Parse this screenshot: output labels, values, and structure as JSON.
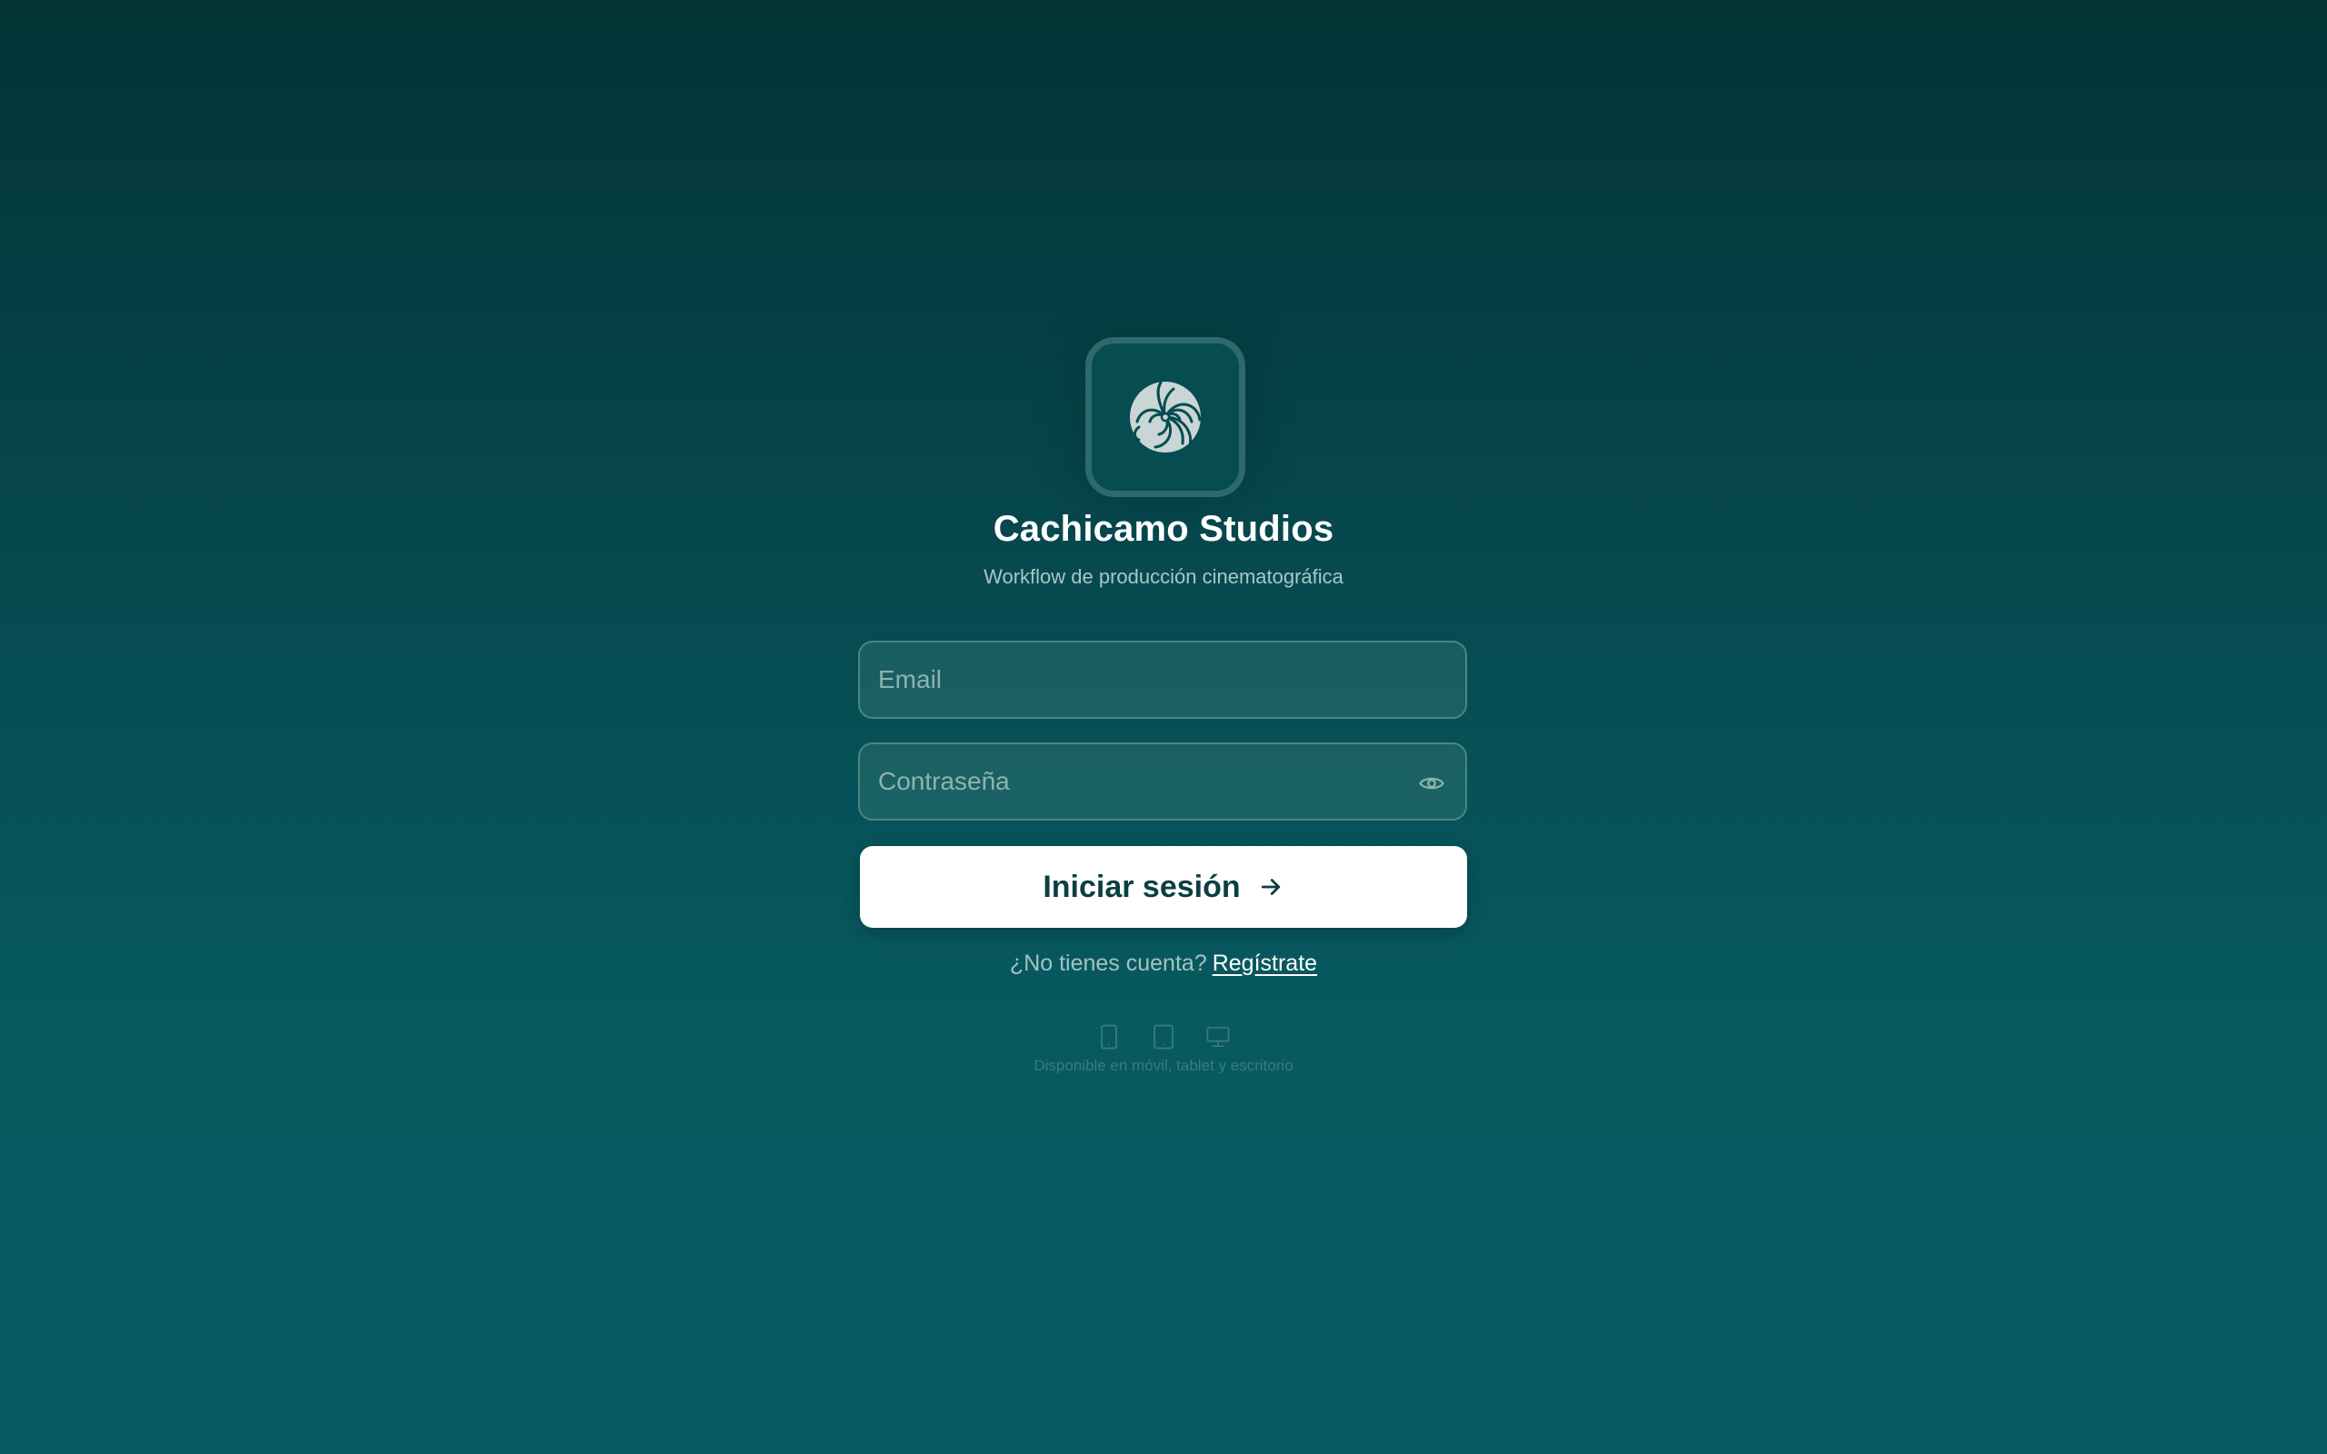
{
  "brand": {
    "name": "Cachicamo Studios",
    "tagline": "Workflow de producción cinematográfica",
    "logo_icon": "armadillo-swirl-logo"
  },
  "login_form": {
    "email_placeholder": "Email",
    "password_placeholder": "Contraseña",
    "toggle_password_icon": "eye-icon",
    "submit_label": "Iniciar sesión",
    "submit_icon": "arrow-right-icon"
  },
  "signup": {
    "prompt": "¿No tienes cuenta?",
    "link_label": "Regístrate"
  },
  "availability": {
    "icons": [
      "smartphone-icon",
      "tablet-icon",
      "desktop-icon"
    ],
    "caption": "Disponible en móvil, tablet y escritorio"
  },
  "colors": {
    "background_top": "#033335",
    "background_bottom": "#075b62",
    "button_bg": "#ffffff",
    "button_text": "#0a3f43"
  }
}
